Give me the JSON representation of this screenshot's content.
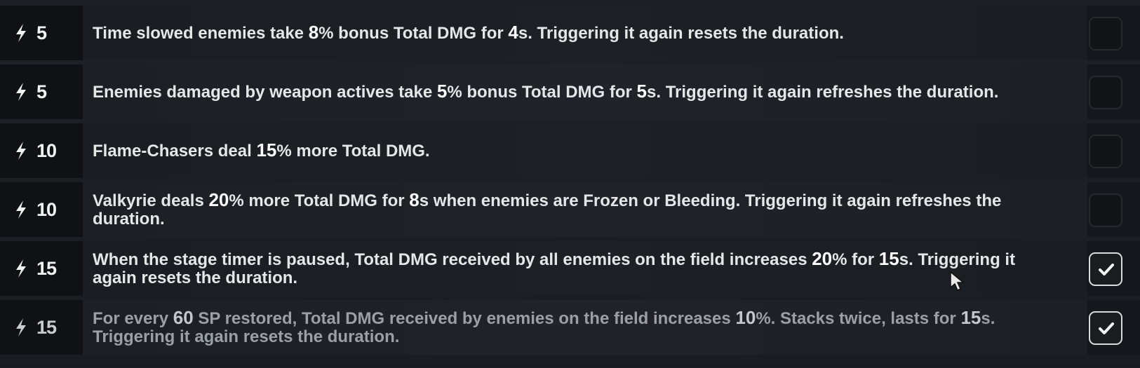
{
  "rows": [
    {
      "cost": "5",
      "text": [
        {
          "t": "Time slowed enemies take ",
          "b": false
        },
        {
          "t": "8",
          "b": true
        },
        {
          "t": "% bonus Total DMG for ",
          "b": false
        },
        {
          "t": "4",
          "b": true
        },
        {
          "t": "s. Triggering it again resets the duration.",
          "b": false
        }
      ],
      "checked": false,
      "dim": false
    },
    {
      "cost": "5",
      "text": [
        {
          "t": "Enemies damaged by weapon actives take ",
          "b": false
        },
        {
          "t": "5",
          "b": true
        },
        {
          "t": "% bonus Total DMG for ",
          "b": false
        },
        {
          "t": "5",
          "b": true
        },
        {
          "t": "s. Triggering it again refreshes the duration.",
          "b": false
        }
      ],
      "checked": false,
      "dim": false
    },
    {
      "cost": "10",
      "text": [
        {
          "t": "Flame-Chasers deal ",
          "b": false
        },
        {
          "t": "15",
          "b": true
        },
        {
          "t": "% more Total DMG.",
          "b": false
        }
      ],
      "checked": false,
      "dim": false
    },
    {
      "cost": "10",
      "text": [
        {
          "t": "Valkyrie deals ",
          "b": false
        },
        {
          "t": "20",
          "b": true
        },
        {
          "t": "% more Total DMG for ",
          "b": false
        },
        {
          "t": "8",
          "b": true
        },
        {
          "t": "s when enemies are Frozen or Bleeding. Triggering it again refreshes the duration.",
          "b": false
        }
      ],
      "checked": false,
      "dim": false
    },
    {
      "cost": "15",
      "text": [
        {
          "t": "When the stage timer is paused, Total DMG received by all enemies on the field increases ",
          "b": false
        },
        {
          "t": "20",
          "b": true
        },
        {
          "t": "% for ",
          "b": false
        },
        {
          "t": "15",
          "b": true
        },
        {
          "t": "s. Triggering it again resets the duration.",
          "b": false
        }
      ],
      "checked": true,
      "dim": false
    },
    {
      "cost": "15",
      "text": [
        {
          "t": "For every ",
          "b": false
        },
        {
          "t": "60",
          "b": true
        },
        {
          "t": " SP restored, Total DMG received by enemies on the field increases ",
          "b": false
        },
        {
          "t": "10",
          "b": true
        },
        {
          "t": "%. Stacks twice, lasts for ",
          "b": false
        },
        {
          "t": "15",
          "b": true
        },
        {
          "t": "s. Triggering it again resets the duration.",
          "b": false
        }
      ],
      "checked": true,
      "dim": true
    }
  ],
  "icons": {
    "cost": "lightning-bolt-icon",
    "check": "checkmark-icon",
    "cursor": "mouse-pointer-icon"
  },
  "colors": {
    "background": "#15181c",
    "cost_cell": "#0f1115",
    "text": "#e4e6e8",
    "dim_text": "#9ba0a6",
    "checkbox_border_checked": "#d8dadc"
  }
}
